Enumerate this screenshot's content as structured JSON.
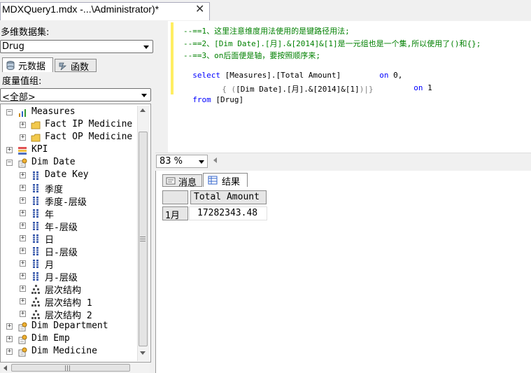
{
  "window": {
    "title": "MDXQuery1.mdx -...\\Administrator)*",
    "close_glyph": "✕"
  },
  "left": {
    "cube_label": "多维数据集:",
    "cube_value": "Drug",
    "tabs": [
      {
        "label": "元数据"
      },
      {
        "label": "函数"
      }
    ],
    "measure_group_label": "度量值组:",
    "measure_group_value": "<全部>",
    "tree": [
      {
        "label": "Measures",
        "icon": "measures-icon"
      },
      {
        "label": "Fact IP Medicine",
        "icon": "folder-icon"
      },
      {
        "label": "Fact OP Medicine",
        "icon": "folder-icon"
      },
      {
        "label": "KPI",
        "icon": "kpi-icon"
      },
      {
        "label": "Dim Date",
        "icon": "dimension-icon"
      },
      {
        "label": "Date Key",
        "icon": "attribute-icon"
      },
      {
        "label": "季度",
        "icon": "attribute-icon"
      },
      {
        "label": "季度-层级",
        "icon": "attribute-icon"
      },
      {
        "label": "年",
        "icon": "attribute-icon"
      },
      {
        "label": "年-层级",
        "icon": "attribute-icon"
      },
      {
        "label": "日",
        "icon": "attribute-icon"
      },
      {
        "label": "日-层级",
        "icon": "attribute-icon"
      },
      {
        "label": "月",
        "icon": "attribute-icon"
      },
      {
        "label": "月-层级",
        "icon": "attribute-icon"
      },
      {
        "label": "层次结构",
        "icon": "hierarchy-icon"
      },
      {
        "label": "层次结构 1",
        "icon": "hierarchy-icon"
      },
      {
        "label": "层次结构 2",
        "icon": "hierarchy-icon"
      },
      {
        "label": "Dim Department",
        "icon": "dimension-icon"
      },
      {
        "label": "Dim Emp",
        "icon": "dimension-icon"
      },
      {
        "label": "Dim Medicine",
        "icon": "dimension-icon"
      }
    ]
  },
  "editor": {
    "line1": "--==1、这里注意维度用法使用的是键路径用法;",
    "line2": "--==2、[Dim Date].[月].&[2014]&[1]是一元组也是一个集,所以使用了()和{};",
    "line3": "--==3、on后面便是轴，要按照顺序来;",
    "line4_kw": "select",
    "line4_txt": " [Measures].[Total Amount]",
    "line4_on": "on",
    "line4_num": " 0,",
    "line5_open": "{ (",
    "line5_txt": "[Dim Date].[月].&[2014]&[1]",
    "line5_close": ")|}",
    "line5_on": "on",
    "line5_num": " 1",
    "line6_kw": "from",
    "line6_txt": " [Drug]"
  },
  "zoom": {
    "value": "83 %"
  },
  "results": {
    "tabs": [
      {
        "label": "消息"
      },
      {
        "label": "结果"
      }
    ],
    "columns": [
      "",
      "Total Amount"
    ],
    "rows": [
      {
        "header": "1月",
        "value": "17282343.48"
      }
    ]
  }
}
